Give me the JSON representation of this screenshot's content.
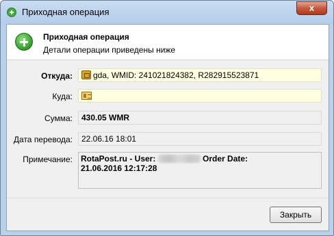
{
  "window": {
    "title": "Приходная операция",
    "close_symbol": "x"
  },
  "header": {
    "title": "Приходная операция",
    "subtitle": "Детали операции приведены ниже",
    "icon": "green-plus-circle"
  },
  "fields": {
    "from": {
      "label": "Откуда:",
      "value": "gda, WMID: 241021824382, R282915523871",
      "icon": "purse-icon"
    },
    "to": {
      "label": "Куда:",
      "value": "",
      "icon": "card-icon"
    },
    "amount": {
      "label": "Сумма:",
      "value": "430.05 WMR"
    },
    "date": {
      "label": "Дата перевода:",
      "value": "22.06.16 18:01"
    },
    "note": {
      "label": "Примечание:",
      "text_before": "RotaPost.ru - User: ",
      "text_after": " Order Date:",
      "text_line2": "21.06.2016 12:17:28"
    }
  },
  "buttons": {
    "close_label": "Закрыть"
  }
}
